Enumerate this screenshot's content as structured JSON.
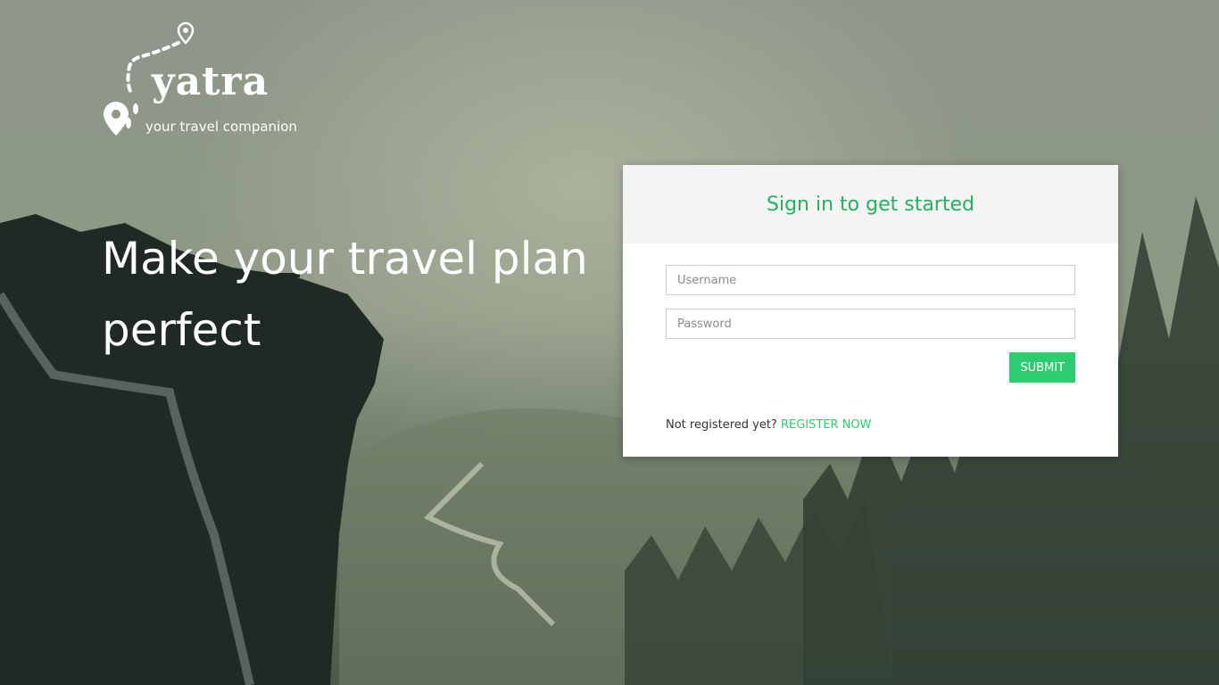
{
  "colors": {
    "accent": "#2ecc71",
    "title_green": "#27ae60",
    "card_header_bg": "#f4f4f4"
  },
  "logo": {
    "brand": "yatra",
    "tagline": "your travel companion",
    "icon": "map-pin-footsteps-icon"
  },
  "hero": {
    "headline": "Make your travel plan perfect"
  },
  "login": {
    "title": "Sign in to get started",
    "username": {
      "value": "",
      "placeholder": "Username"
    },
    "password": {
      "value": "",
      "placeholder": "Password"
    },
    "submit_label": "SUBMIT",
    "register_prompt": "Not registered yet?",
    "register_link": "REGISTER NOW"
  }
}
